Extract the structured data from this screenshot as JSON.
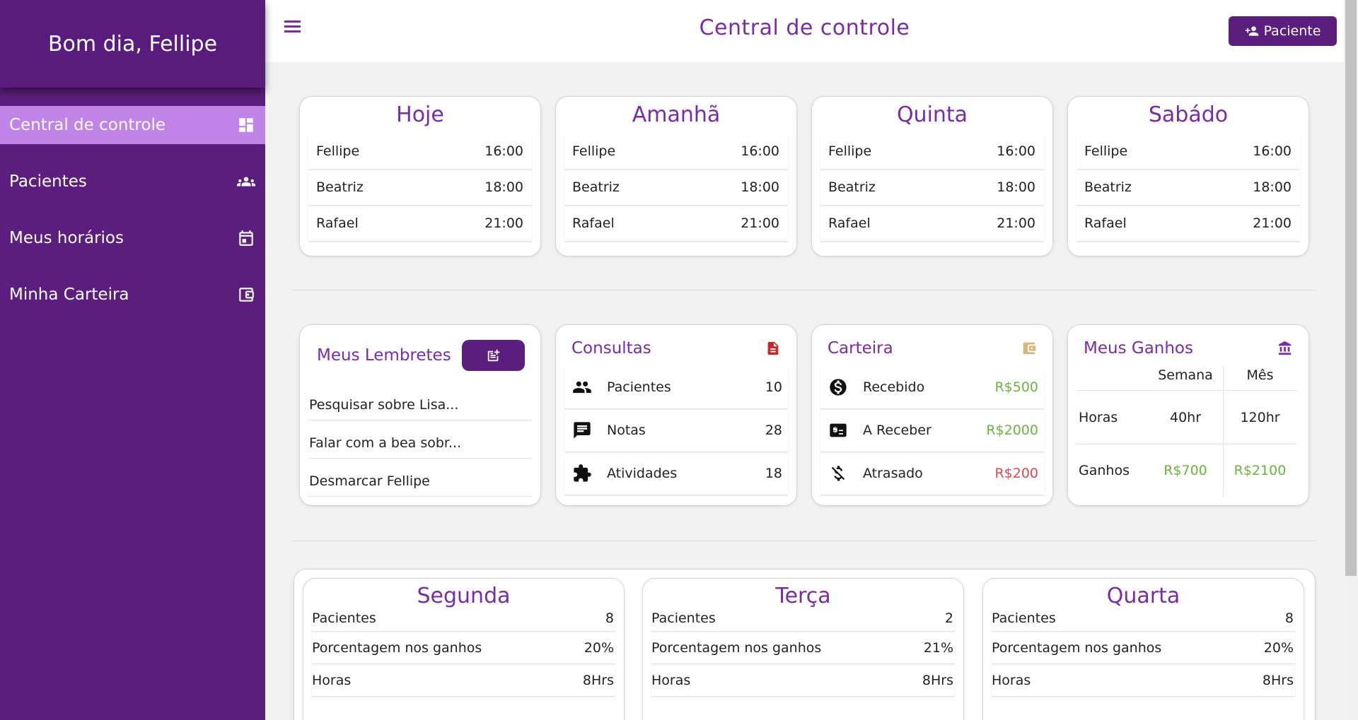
{
  "sidebar": {
    "greeting": "Bom dia, Fellipe",
    "items": [
      {
        "label": "Central de controle",
        "icon": "dashboard-icon"
      },
      {
        "label": "Pacientes",
        "icon": "group-icon"
      },
      {
        "label": "Meus horários",
        "icon": "calendar-icon"
      },
      {
        "label": "Minha Carteira",
        "icon": "wallet-icon"
      }
    ]
  },
  "header": {
    "title": "Central de controle",
    "patient_button": "Paciente"
  },
  "days": [
    {
      "title": "Hoje",
      "rows": [
        {
          "name": "Fellipe",
          "time": "16:00"
        },
        {
          "name": "Beatriz",
          "time": "18:00"
        },
        {
          "name": "Rafael",
          "time": "21:00"
        }
      ]
    },
    {
      "title": "Amanhã",
      "rows": [
        {
          "name": "Fellipe",
          "time": "16:00"
        },
        {
          "name": "Beatriz",
          "time": "18:00"
        },
        {
          "name": "Rafael",
          "time": "21:00"
        }
      ]
    },
    {
      "title": "Quinta",
      "rows": [
        {
          "name": "Fellipe",
          "time": "16:00"
        },
        {
          "name": "Beatriz",
          "time": "18:00"
        },
        {
          "name": "Rafael",
          "time": "21:00"
        }
      ]
    },
    {
      "title": "Sabádo",
      "rows": [
        {
          "name": "Fellipe",
          "time": "16:00"
        },
        {
          "name": "Beatriz",
          "time": "18:00"
        },
        {
          "name": "Rafael",
          "time": "21:00"
        }
      ]
    }
  ],
  "reminders": {
    "title": "Meus Lembretes",
    "items": [
      "Pesquisar sobre Lisa...",
      "Falar com a bea sobr...",
      "Desmarcar Fellipe"
    ]
  },
  "consultas": {
    "title": "Consultas",
    "rows": [
      {
        "label": "Pacientes",
        "value": "10"
      },
      {
        "label": "Notas",
        "value": "28"
      },
      {
        "label": "Atividades",
        "value": "18"
      }
    ]
  },
  "carteira": {
    "title": "Carteira",
    "rows": [
      {
        "label": "Recebido",
        "value": "R$500"
      },
      {
        "label": "A Receber",
        "value": "R$2000"
      },
      {
        "label": "Atrasado",
        "value": "R$200"
      }
    ]
  },
  "ganhos": {
    "title": "Meus Ganhos",
    "col_week": "Semana",
    "col_month": "Mês",
    "rows": [
      {
        "label": "Horas",
        "week": "40hr",
        "month": "120hr"
      },
      {
        "label": "Ganhos",
        "week": "R$700",
        "month": "R$2100"
      }
    ]
  },
  "weekdays": [
    {
      "title": "Segunda",
      "rows": [
        {
          "label": "Pacientes",
          "value": "8"
        },
        {
          "label": "Porcentagem nos ganhos",
          "value": "20%"
        },
        {
          "label": "Horas",
          "value": "8Hrs"
        }
      ]
    },
    {
      "title": "Terça",
      "rows": [
        {
          "label": "Pacientes",
          "value": "2"
        },
        {
          "label": "Porcentagem nos ganhos",
          "value": "21%"
        },
        {
          "label": "Horas",
          "value": "8Hrs"
        }
      ]
    },
    {
      "title": "Quarta",
      "rows": [
        {
          "label": "Pacientes",
          "value": "8"
        },
        {
          "label": "Porcentagem nos ganhos",
          "value": "20%"
        },
        {
          "label": "Horas",
          "value": "8Hrs"
        }
      ]
    }
  ],
  "colors": {
    "primary": "#5c1e7e",
    "accent_text": "#7b2aa8",
    "active_item": "#c084e8",
    "positive": "#6cb33f",
    "negative": "#e0474c"
  }
}
